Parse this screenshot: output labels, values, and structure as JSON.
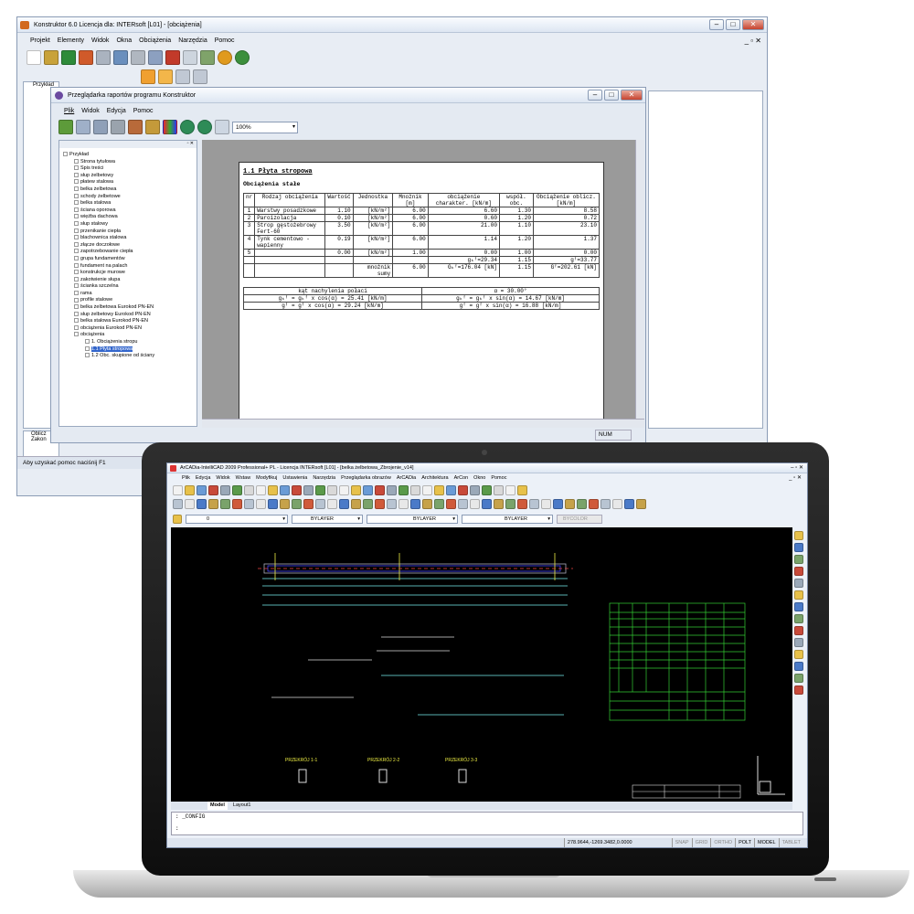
{
  "konstruktor": {
    "title": "Konstruktor 6.0 Licencja dla: INTERsoft [L01] - [obciążenia]",
    "menu": [
      "Projekt",
      "Elementy",
      "Widok",
      "Okna",
      "Obciążenia",
      "Narzędzia",
      "Pomoc"
    ],
    "status": "Aby uzyskać pomoc naciśnij F1",
    "left_tree_root": "Przykład",
    "bottom_panel": [
      "Oblicz",
      "Zakon"
    ]
  },
  "viewer": {
    "title": "Przeglądarka raportów programu Konstruktor",
    "menu": [
      "Plik",
      "Widok",
      "Edycja",
      "Pomoc"
    ],
    "zoom": "100%",
    "status_num": "NUM",
    "tree": [
      {
        "label": "Przykład",
        "level": 0
      },
      {
        "label": "Strona tytułowa",
        "level": 1
      },
      {
        "label": "Spis treści",
        "level": 1
      },
      {
        "label": "słup żelbetowy",
        "level": 1
      },
      {
        "label": "płatew stalowa",
        "level": 1
      },
      {
        "label": "belka żelbetowa",
        "level": 1
      },
      {
        "label": "schody żelbetowe",
        "level": 1
      },
      {
        "label": "belka stalowa",
        "level": 1
      },
      {
        "label": "ściana oporowa",
        "level": 1
      },
      {
        "label": "więźba dachowa",
        "level": 1
      },
      {
        "label": "słup stalowy",
        "level": 1
      },
      {
        "label": "przenikanie ciepła",
        "level": 1
      },
      {
        "label": "blachownica stalowa",
        "level": 1
      },
      {
        "label": "złącze doczołowe",
        "level": 1
      },
      {
        "label": "zapotrzebowanie ciepła",
        "level": 1
      },
      {
        "label": "grupa fundamentów",
        "level": 1
      },
      {
        "label": "fundament na palach",
        "level": 1
      },
      {
        "label": "konstrukcje murowe",
        "level": 1
      },
      {
        "label": "zakotwienie słupa",
        "level": 1
      },
      {
        "label": "ścianka szczelna",
        "level": 1
      },
      {
        "label": "rama",
        "level": 1
      },
      {
        "label": "profile stalowe",
        "level": 1
      },
      {
        "label": "belka żelbetowa Eurokod PN-EN",
        "level": 1
      },
      {
        "label": "słup żelbetowy Eurokod PN-EN",
        "level": 1
      },
      {
        "label": "belka stalowa Eurokod PN-EN",
        "level": 1
      },
      {
        "label": "obciążenia Eurokod PN-EN",
        "level": 1
      },
      {
        "label": "obciążenia",
        "level": 1
      },
      {
        "label": "1. Obciążenia stropu",
        "level": 2
      },
      {
        "label": "1.1 Płyta stropowa",
        "level": 2,
        "selected": true
      },
      {
        "label": "1.2 Obc. skupione od ściany",
        "level": 2
      }
    ],
    "report": {
      "heading": "1.1 Płyta stropowa",
      "subheading": "Obciążenia stałe",
      "headers": [
        "nr",
        "Rodzaj obciążenia",
        "Wartość",
        "Jednostka",
        "Mnożnik [m]",
        "obciążenie charakter. [kN/m]",
        "współ. obc.",
        "Obciążenie oblicz. [kN/m]"
      ],
      "rows": [
        [
          "1",
          "Warstwy posadzkowe",
          "1.10",
          "[kN/m²]",
          "6.00",
          "6.60",
          "1.30",
          "8.58"
        ],
        [
          "2",
          "Paroizolacja",
          "0.10",
          "[kN/m²]",
          "6.00",
          "0.60",
          "1.20",
          "0.72"
        ],
        [
          "3",
          "Strop gęstożebrowy Fert-60",
          "3.50",
          "[kN/m²]",
          "6.00",
          "21.00",
          "1.10",
          "23.10"
        ],
        [
          "4",
          "Tynk cementowo - wapienny",
          "0.19",
          "[kN/m²]",
          "6.00",
          "1.14",
          "1.20",
          "1.37"
        ],
        [
          "5",
          "",
          "0.00",
          "[kN/m²]",
          "1.00",
          "0.00",
          "1.00",
          "0.00"
        ],
        [
          "",
          "",
          "",
          "",
          "",
          "gₖᶠ=29.34",
          "1.15",
          "gᶠ=33.77"
        ],
        [
          "",
          "",
          "",
          "mnożnik sumy",
          "6.00",
          "Gₖᶠ=176.04 [kN]",
          "1.15",
          "Gᶠ=202.61 [kN]"
        ]
      ],
      "angle_label": "kąt nachylenia połaci",
      "angle_value": "α = 30.00°",
      "formulas": [
        "gₖᶠ = gₖᶠ x cos(α) = 25.41 [kN/m]",
        "gₖᶠ = gₖᶠ x sin(α) = 14.67 [kN/m]",
        "gᶠ = gᶠ x cos(α) = 29.24 [kN/m]",
        "gᶠ = gᶠ x sin(α) = 16.88 [kN/m]"
      ]
    }
  },
  "arcadia": {
    "title": "ArCADia-IntelliCAD 2009 Professional+ PL - Licencja INTERsoft [L01] - [belka żelbetowa_Zbrojenie_v14]",
    "menu": [
      "Plik",
      "Edycja",
      "Widok",
      "Wstaw",
      "Modyfikuj",
      "Ustawienia",
      "Narzędzia",
      "Przeglądarka obrazów",
      "ArCADia",
      "Architektura",
      "ArCon",
      "Okno",
      "Pomoc"
    ],
    "layer": "0",
    "bylayer1": "BYLAYER",
    "bylayer2": "BYLAYER",
    "bylayer3": "BYLAYER",
    "color": "BYCOLOR",
    "tabs": [
      "Model",
      "Layout1"
    ],
    "command": ": _CONFIG",
    "prompt": ":",
    "coords": "278.9644,-1269.3482,0.0000",
    "status": [
      "SNAP",
      "GRID",
      "ORTHO",
      "POLT",
      "MODEL",
      "TABLET"
    ],
    "section_labels": [
      "PRZEKRÓJ 1-1",
      "PRZEKRÓJ 2-2",
      "PRZEKRÓJ 3-3"
    ]
  }
}
